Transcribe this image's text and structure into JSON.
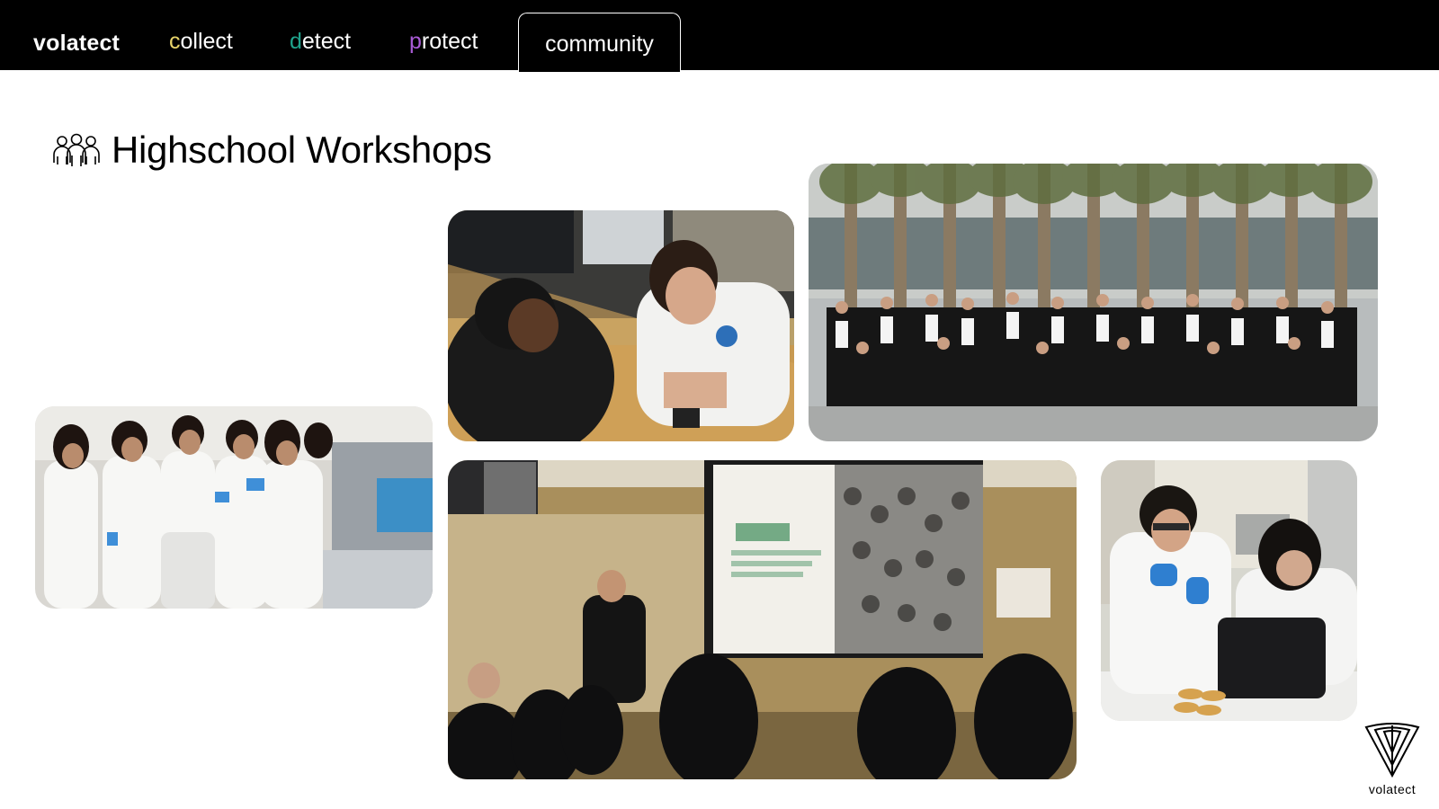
{
  "nav": {
    "brand": "volatect",
    "items": [
      {
        "first": "c",
        "rest": "ollect",
        "accent": "#e8d46a"
      },
      {
        "first": "d",
        "rest": "etect",
        "accent": "#1fa38c"
      },
      {
        "first": "p",
        "rest": "rotect",
        "accent": "#a95bd6"
      },
      {
        "label": "community"
      }
    ]
  },
  "section": {
    "title": "Highschool Workshops",
    "icon": "people-group-icon"
  },
  "photos": [
    {
      "name": "students-soldering-photo"
    },
    {
      "name": "group-photo-outdoor"
    },
    {
      "name": "lab-tour-photo"
    },
    {
      "name": "lecture-hall-presentation-photo"
    },
    {
      "name": "pipetting-lab-photo"
    }
  ],
  "logo": {
    "text": "volatect",
    "icon": "shield-logo-icon"
  },
  "colors": {
    "nav_bg": "#000000",
    "page_bg": "#ffffff"
  }
}
